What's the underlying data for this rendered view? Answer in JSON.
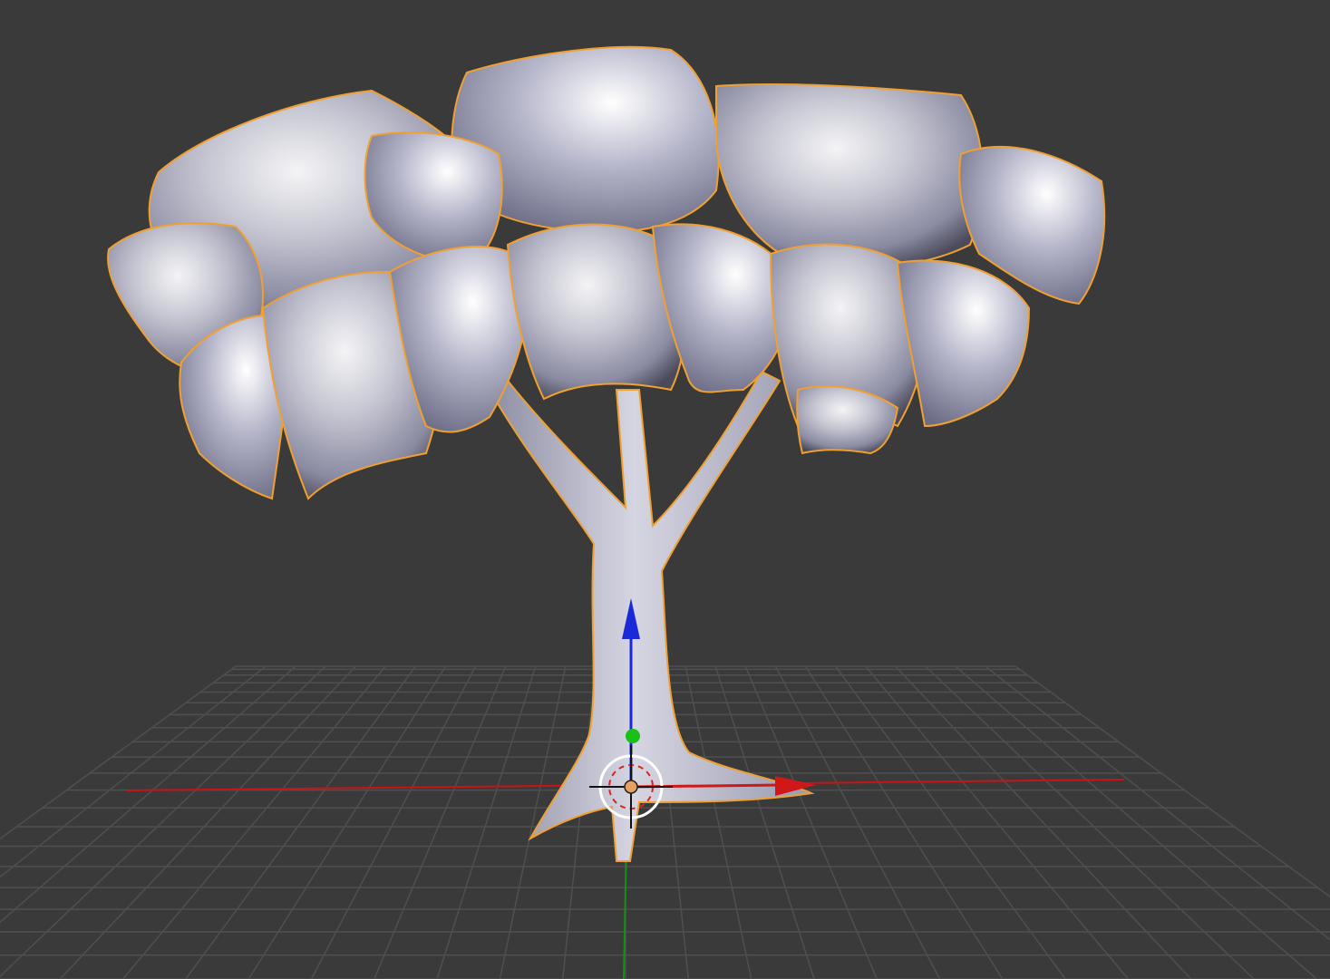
{
  "app": "3D Viewport",
  "viewport": {
    "background_color": "#3a3a3a",
    "grid_color": "#4f4f4f",
    "grid_visible": true
  },
  "scene": {
    "objects": [
      {
        "name": "tree",
        "selected": true,
        "outline_color": "#f0a030",
        "material_color": "#c8c8d8"
      }
    ],
    "axes": {
      "x_color": "#d01818",
      "y_color": "#18a018",
      "z_color": "#1a2ad8"
    },
    "manipulator": {
      "type": "translate",
      "visible": true
    },
    "cursor_3d": {
      "visible": true
    },
    "origin_marker_color": "#e8a060"
  }
}
